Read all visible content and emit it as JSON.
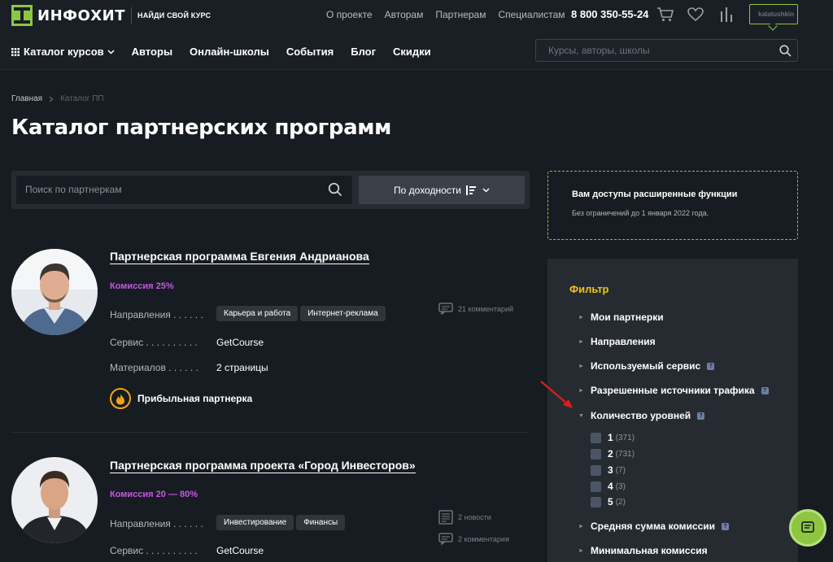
{
  "header": {
    "logo_text": "ИНФОХИТ",
    "logo_tagline": "НАЙДИ СВОЙ КУРС",
    "top_links": [
      "О проекте",
      "Авторам",
      "Партнерам",
      "Специалистам"
    ],
    "phone": "8 800 350-55-24",
    "username": "kalatushkin",
    "nav": {
      "catalog_label": "Каталог курсов",
      "items": [
        "Авторы",
        "Онлайн-школы",
        "События",
        "Блог",
        "Скидки"
      ]
    },
    "search_placeholder": "Курсы, авторы, школы"
  },
  "breadcrumb": {
    "home": "Главная",
    "current": "Каталог ПП"
  },
  "page_title": "Каталог партнерских программ",
  "toolbar": {
    "search_placeholder": "Поиск по партнеркам",
    "sort_label": "По доходности"
  },
  "info": {
    "title": "Вам доступы расширенные функции",
    "subtitle": "Без ограничений до 1 января 2022 года."
  },
  "filter": {
    "title": "Фильтр",
    "items": [
      {
        "label": "Мои партнерки",
        "help": false
      },
      {
        "label": "Направления",
        "help": false
      },
      {
        "label": "Используемый сервис",
        "help": true
      },
      {
        "label": "Разрешенные источники трафика",
        "help": true
      },
      {
        "label": "Количество уровней",
        "help": true,
        "expanded": true
      },
      {
        "label": "Средняя сумма комиссии",
        "help": true
      },
      {
        "label": "Минимальная комиссия",
        "help": false
      }
    ],
    "levels": [
      {
        "value": "1",
        "count": "(371)"
      },
      {
        "value": "2",
        "count": "(731)"
      },
      {
        "value": "3",
        "count": "(7)"
      },
      {
        "value": "4",
        "count": "(3)"
      },
      {
        "value": "5",
        "count": "(2)"
      }
    ]
  },
  "cards": [
    {
      "title": "Партнерская программа Евгения Андрианова",
      "commission": "Комиссия 25%",
      "directions_label": "Направления . . . . . .",
      "tags": [
        "Карьера и работа",
        "Интернет-реклама"
      ],
      "service_label": "Сервис . . . . . . . . . .",
      "service": "GetCourse",
      "materials_label": "Материалов . . . . . .",
      "materials": "2 страницы",
      "comments": "21 комментарий",
      "badge": "Прибыльная партнерка"
    },
    {
      "title": "Партнерская программа проекта «Город Инвесторов»",
      "commission": "Комиссия 20 — 80%",
      "directions_label": "Направления . . . . . .",
      "tags": [
        "Инвестирование",
        "Финансы"
      ],
      "service_label": "Сервис . . . . . . . . . .",
      "service": "GetCourse",
      "news": "2 новости",
      "comments": "2 комментария"
    }
  ],
  "colors": {
    "background": "#171c22",
    "accent_green": "#8dc640",
    "commission_purple": "#c657e0",
    "filter_title_yellow": "#f0c419",
    "arrow_red": "#e01c1c"
  }
}
